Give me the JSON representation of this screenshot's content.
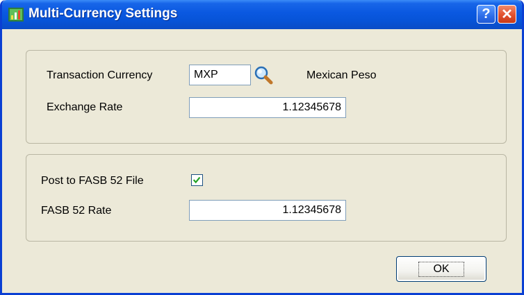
{
  "window": {
    "title": "Multi-Currency Settings",
    "help_symbol": "?",
    "close_symbol": "✕"
  },
  "currency_group": {
    "transaction_currency_label": "Transaction Currency",
    "transaction_currency_value": "MXP",
    "lookup_icon": "magnifier-icon",
    "currency_name": "Mexican Peso",
    "exchange_rate_label": "Exchange Rate",
    "exchange_rate_value": "1.12345678"
  },
  "fasb_group": {
    "post_to_fasb_label": "Post to FASB 52 File",
    "post_to_fasb_checked": true,
    "fasb_rate_label": "FASB 52 Rate",
    "fasb_rate_value": "1.12345678"
  },
  "buttons": {
    "ok_label": "OK"
  },
  "colors": {
    "title_bar": "#0a58e0",
    "dialog_bg": "#ece9d8",
    "check_mark": "#21a121"
  }
}
